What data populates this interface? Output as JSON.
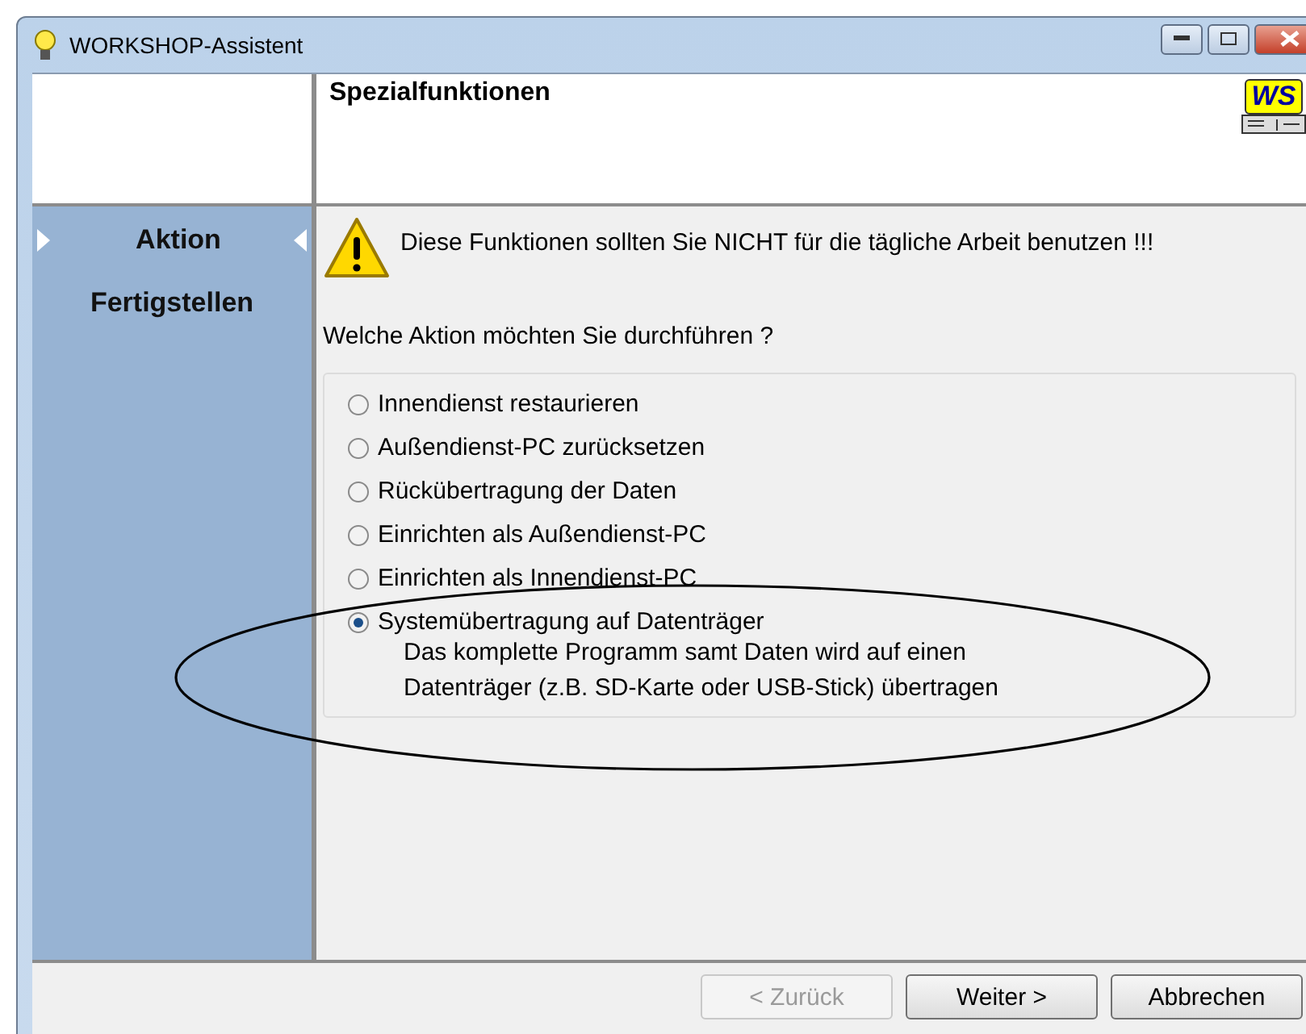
{
  "window": {
    "title": "WORKSHOP-Assistent"
  },
  "header": {
    "title": "Spezialfunktionen",
    "logo": "WS"
  },
  "sidebar": {
    "items": [
      {
        "label": "Aktion",
        "selected": true
      },
      {
        "label": "Fertigstellen",
        "selected": false
      }
    ]
  },
  "warning": "Diese Funktionen sollten Sie NICHT für die tägliche Arbeit benutzen !!!",
  "question": "Welche Aktion möchten Sie durchführen ?",
  "options": [
    {
      "label": "Innendienst restaurieren",
      "selected": false
    },
    {
      "label": "Außendienst-PC zurücksetzen",
      "selected": false
    },
    {
      "label": "Rückübertragung der Daten",
      "selected": false
    },
    {
      "label": "Einrichten als Außendienst-PC",
      "selected": false
    },
    {
      "label": "Einrichten als Innendienst-PC",
      "selected": false
    },
    {
      "label": "Systemübertragung auf Datenträger",
      "selected": true,
      "description": [
        "Das komplette Programm samt Daten wird auf einen",
        "Datenträger (z.B. SD-Karte oder USB-Stick) übertragen"
      ]
    }
  ],
  "buttons": [
    {
      "label": "< Zurück",
      "disabled": true
    },
    {
      "label": "Weiter >",
      "disabled": false
    },
    {
      "label": "Abbrechen",
      "disabled": false
    }
  ]
}
